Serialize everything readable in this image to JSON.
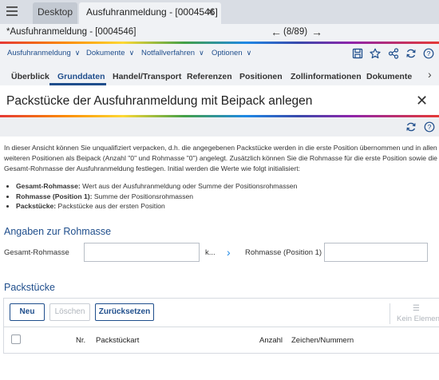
{
  "window": {
    "tabs": [
      "Desktop",
      "Ausfuhranmeldung - [0004546]"
    ],
    "close_glyph": "✕"
  },
  "titlebar": {
    "title": "*Ausfuhranmeldung - [0004546]",
    "position": "(8/89)"
  },
  "menu": {
    "items": [
      "Ausfuhranmeldung",
      "Dokumente",
      "Notfallverfahren",
      "Optionen"
    ],
    "tool_icons": [
      "save-icon",
      "star-icon",
      "share-icon",
      "refresh-icon",
      "help-icon"
    ]
  },
  "nav_tabs": {
    "items": [
      "Überblick",
      "Grunddaten",
      "Handel/Transport",
      "Referenzen",
      "Positionen",
      "Zollinformationen",
      "Dokumente"
    ],
    "active_index": 1
  },
  "dialog": {
    "title": "Packstücke der Ausfuhranmeldung mit Beipack anlegen",
    "intro_lines": [
      "In dieser Ansicht können Sie unqualifiziert verpacken, d.h. die angegebenen Packstücke werden in die erste Position übernommen und in allen",
      "weiteren Positionen als Beipack (Anzahl \"0\" und Rohmasse \"0\") angelegt. Zusätzlich können Sie die Rohmasse für die erste Position sowie die",
      "Gesamt-Rohmasse der Ausfuhranmeldung festlegen. Initial werden die Werte wie folgt initialisiert:"
    ],
    "bullets": [
      {
        "term": "Gesamt-Rohmasse:",
        "text": " Wert aus der Ausfuhranmeldung oder Summe der Positionsrohmassen"
      },
      {
        "term": "Rohmasse (Position 1):",
        "text": " Summe der Positionsrohmassen"
      },
      {
        "term": "Packstücke:",
        "text": " Packstücke aus der ersten Position"
      }
    ]
  },
  "rohmasse": {
    "section_title": "Angaben zur Rohmasse",
    "gesamt_label": "Gesamt-Rohmasse",
    "gesamt_value": "",
    "unit": "k...",
    "position1_label": "Rohmasse (Position 1)",
    "position1_value": ""
  },
  "packstuecke": {
    "section_title": "Packstücke",
    "buttons": {
      "neu": "Neu",
      "loeschen": "Löschen",
      "zuruecksetzen": "Zurücksetzen"
    },
    "kein_element": "Kein Element",
    "columns": [
      "Nr.",
      "Packstückart",
      "Anzahl",
      "Zeichen/Nummern"
    ],
    "rows": []
  },
  "colors": {
    "accent": "#1f4e8c",
    "tab_bar": "#d9dde4",
    "panel": "#f0f2f5"
  }
}
